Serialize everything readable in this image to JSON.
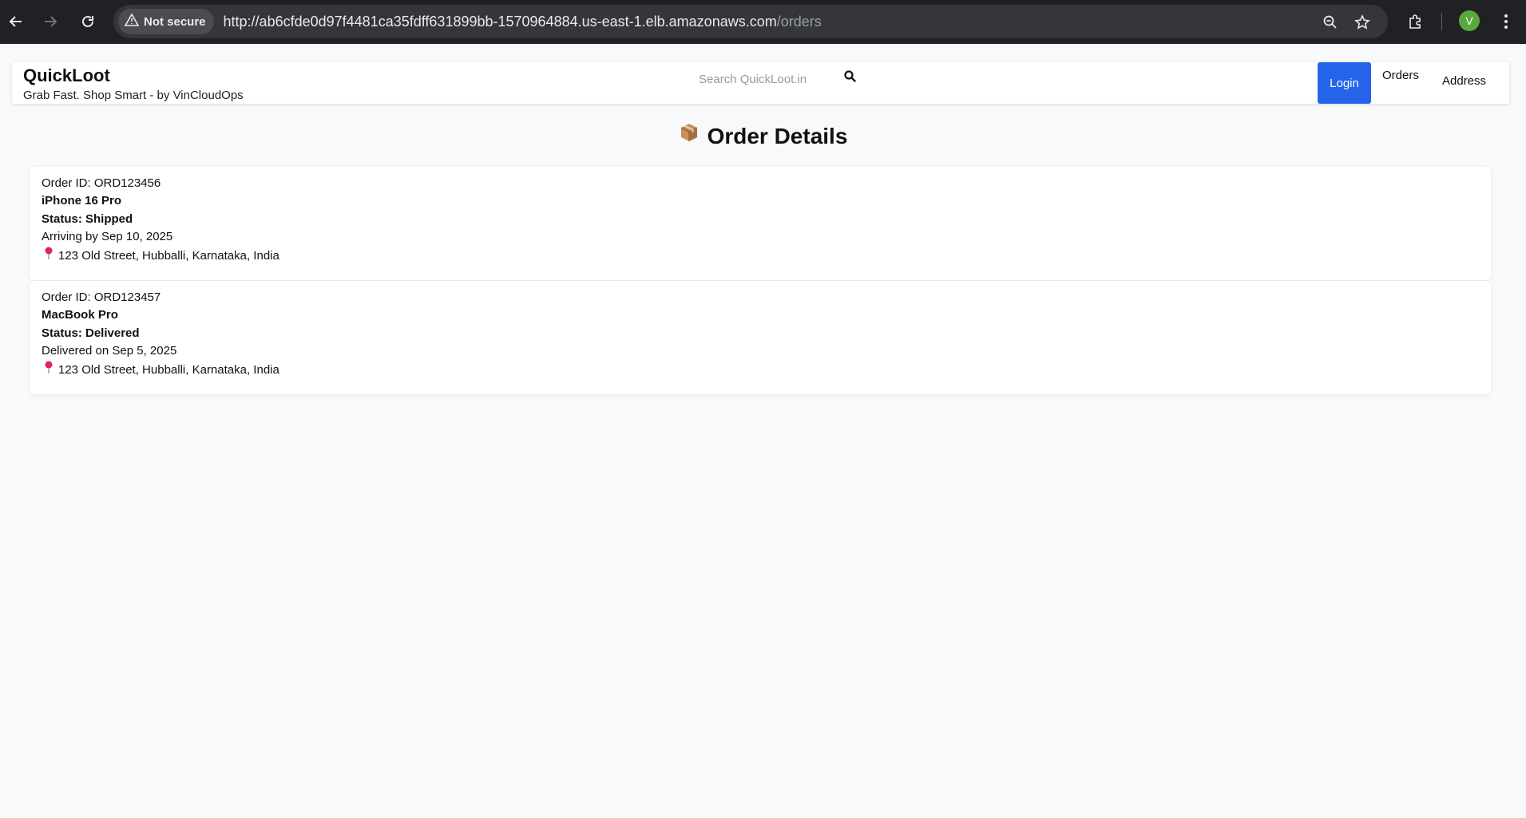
{
  "browser": {
    "security_label": "Not secure",
    "url_host": "http://ab6cfde0d97f4481ca35fdff631899bb-1570964884.us-east-1.elb.amazonaws.com",
    "url_path": "/orders",
    "profile_initial": "V"
  },
  "header": {
    "brand": "QuickLoot",
    "tagline": "Grab Fast. Shop Smart - by VinCloudOps",
    "search_placeholder": "Search QuickLoot.in",
    "login_label": "Login",
    "orders_label": "Orders",
    "address_label": "Address"
  },
  "main": {
    "title": "Order Details",
    "orders": [
      {
        "order_id": "Order ID: ORD123456",
        "product": "iPhone 16 Pro",
        "status": "Status: Shipped",
        "delivery": "Arriving by Sep 10, 2025",
        "address": "123 Old Street, Hubballi, Karnataka, India"
      },
      {
        "order_id": "Order ID: ORD123457",
        "product": "MacBook Pro",
        "status": "Status: Delivered",
        "delivery": "Delivered on Sep 5, 2025",
        "address": "123 Old Street, Hubballi, Karnataka, India"
      }
    ]
  },
  "colors": {
    "accent": "#2563eb",
    "chrome_bg": "#202124",
    "page_bg": "#f8f9fb"
  }
}
